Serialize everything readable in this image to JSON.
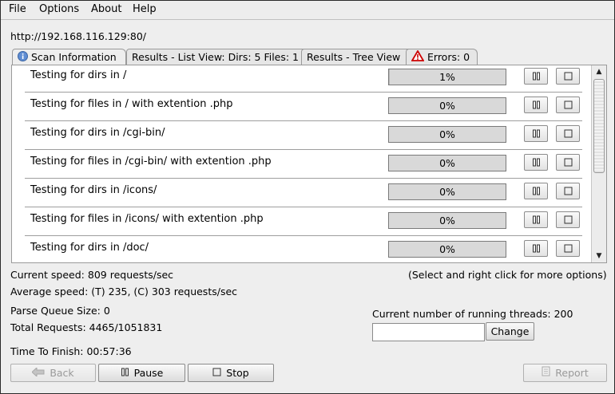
{
  "menu": {
    "items": [
      "File",
      "Options",
      "About",
      "Help"
    ]
  },
  "target_url": "http://192.168.116.129:80/",
  "tabs": [
    {
      "label": "Scan Information",
      "icon": "info-icon"
    },
    {
      "label": "Results - List View: Dirs: 5 Files: 1"
    },
    {
      "label": "Results - Tree View"
    },
    {
      "label": "Errors: 0",
      "icon": "warning-icon"
    }
  ],
  "tasks": [
    {
      "label": "Testing for dirs in /",
      "progress": "1%",
      "progress_value": 0.01
    },
    {
      "label": "Testing for files in / with extention .php",
      "progress": "0%",
      "progress_value": 0
    },
    {
      "label": "Testing for dirs in /cgi-bin/",
      "progress": "0%",
      "progress_value": 0
    },
    {
      "label": "Testing for files in /cgi-bin/ with extention .php",
      "progress": "0%",
      "progress_value": 0
    },
    {
      "label": "Testing for dirs in /icons/",
      "progress": "0%",
      "progress_value": 0
    },
    {
      "label": "Testing for files in /icons/ with extention .php",
      "progress": "0%",
      "progress_value": 0
    },
    {
      "label": "Testing for dirs in /doc/",
      "progress": "0%",
      "progress_value": 0
    }
  ],
  "stats": {
    "current_speed": "Current speed: 809 requests/sec",
    "average_speed": "Average speed: (T) 235, (C) 303 requests/sec",
    "parse_queue": "Parse Queue Size: 0",
    "total_requests": "Total Requests: 4465/1051831",
    "time_to_finish": "Time To Finish: 00:57:36",
    "hint": "(Select and right click for more options)",
    "threads": "Current number of running threads: 200"
  },
  "threads_input": {
    "value": ""
  },
  "buttons": {
    "change": "Change",
    "back": "Back",
    "pause": "Pause",
    "stop": "Stop",
    "report": "Report"
  }
}
